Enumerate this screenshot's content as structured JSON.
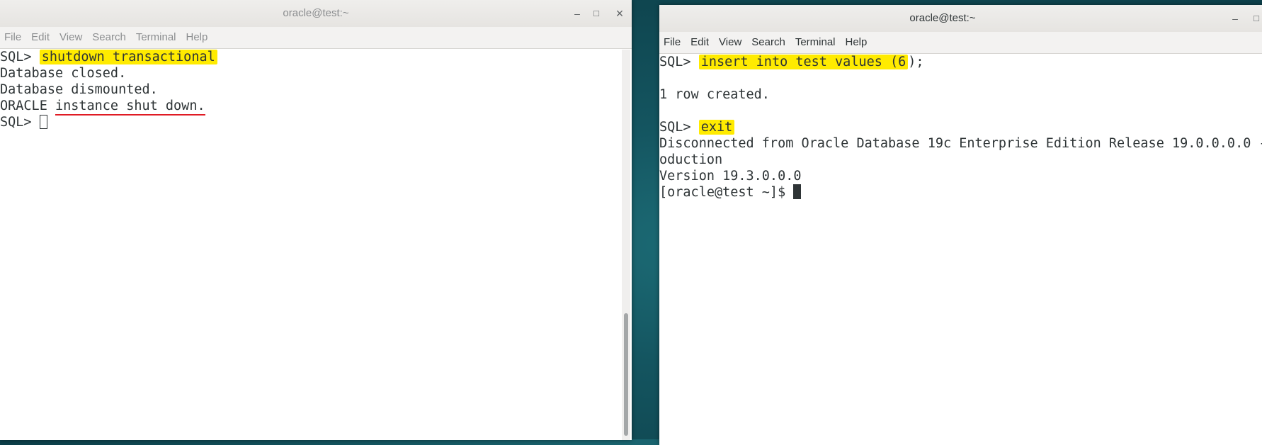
{
  "left_window": {
    "title": "oracle@test:~",
    "controls": {
      "minimize": "–",
      "maximize": "□",
      "close": "×"
    },
    "menu": [
      "File",
      "Edit",
      "View",
      "Search",
      "Terminal",
      "Help"
    ],
    "lines": [
      {
        "prompt": "SQL> ",
        "command": "shutdown transactional"
      },
      {
        "text": "Database closed."
      },
      {
        "text": "Database dismounted."
      },
      {
        "plain": "ORACLE ",
        "underlined": "instance shut down."
      },
      {
        "prompt": "SQL> "
      }
    ]
  },
  "right_window": {
    "title": "oracle@test:~",
    "controls": {
      "minimize": "–",
      "maximize": "□"
    },
    "menu": [
      "File",
      "Edit",
      "View",
      "Search",
      "Terminal",
      "Help"
    ],
    "lines": [
      {
        "prompt": "SQL> ",
        "command_highlighted": "insert into test values (6",
        "command_rest": ");"
      },
      {
        "text": ""
      },
      {
        "text": "1 row created."
      },
      {
        "text": ""
      },
      {
        "prompt": "SQL> ",
        "command": "exit"
      },
      {
        "text": "Disconnected from Oracle Database 19c Enterprise Edition Release 19.0.0.0.0 -"
      },
      {
        "text": "oduction"
      },
      {
        "text": "Version 19.3.0.0.0"
      },
      {
        "prompt": "[oracle@test ~]$ "
      }
    ]
  },
  "colors": {
    "highlight": "#ffeb00",
    "underline": "#e01b24",
    "terminal_text": "#2e3436",
    "desktop": "#145560"
  }
}
